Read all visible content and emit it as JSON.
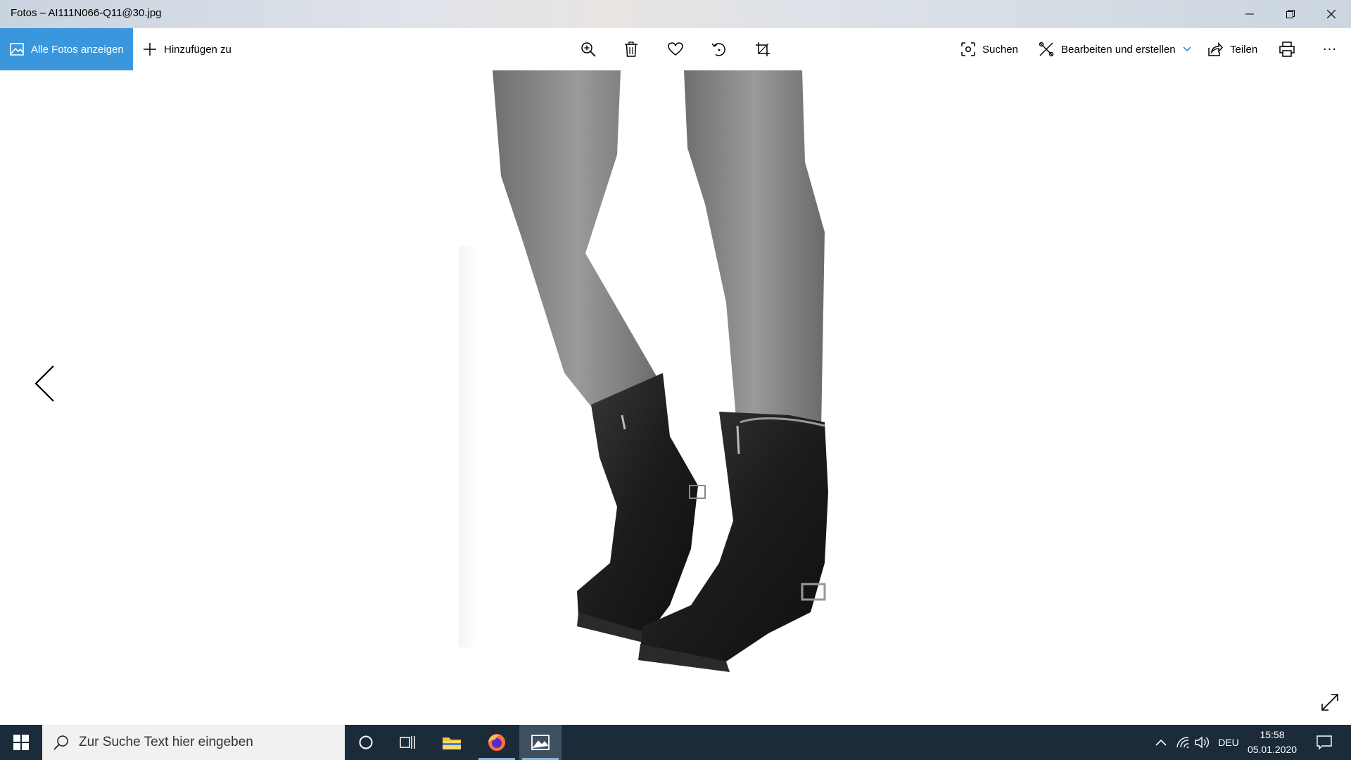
{
  "window": {
    "title": "Fotos – AI111N066-Q11@30.jpg"
  },
  "toolbar": {
    "all_photos_label": "Alle Fotos anzeigen",
    "add_to_label": "Hinzufügen zu",
    "search_label": "Suchen",
    "edit_create_label": "Bearbeiten und erstellen",
    "share_label": "Teilen",
    "more_label": "···"
  },
  "taskbar": {
    "search_placeholder": "Zur Suche Text hier eingeben",
    "language": "DEU",
    "time": "15:58",
    "date": "05.01.2020"
  },
  "colors": {
    "accent": "#3a96dd",
    "taskbar": "#1c2b39"
  }
}
